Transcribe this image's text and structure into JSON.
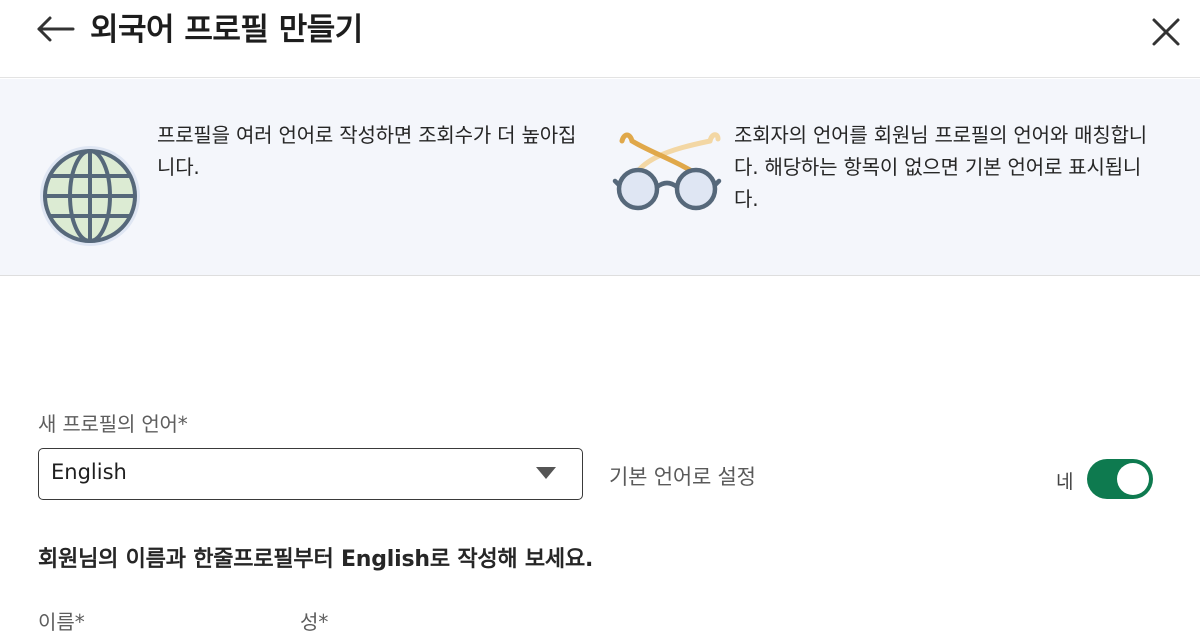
{
  "header": {
    "title": "외국어 프로필 만들기",
    "back_icon": "arrow-left-icon",
    "close_icon": "close-icon"
  },
  "info": {
    "left_text": "프로필을 여러 언어로 작성하면 조회수가 더 높아집니다.",
    "left_icon": "globe-icon",
    "right_text": "조회자의 언어를 회원님 프로필의 언어와 매칭합니다. 해당하는 항목이 없으면 기본 언어로 표시됩니다.",
    "right_icon": "glasses-icon"
  },
  "form": {
    "language_label": "새 프로필의 언어*",
    "language_value": "English",
    "default_language_label": "기본 언어로 설정",
    "default_toggle_state": "네",
    "default_toggle_on": true,
    "name_heading": "회원님의 이름과 한줄프로필부터 English로 작성해 보세요.",
    "first_name_label": "이름*",
    "last_name_label": "성*"
  },
  "colors": {
    "accent_green": "#0e7a4f",
    "panel_bg": "#f4f6fb",
    "globe_fill": "#dcebd3",
    "globe_stroke": "#56687a",
    "glasses_orange": "#e0a84a"
  }
}
